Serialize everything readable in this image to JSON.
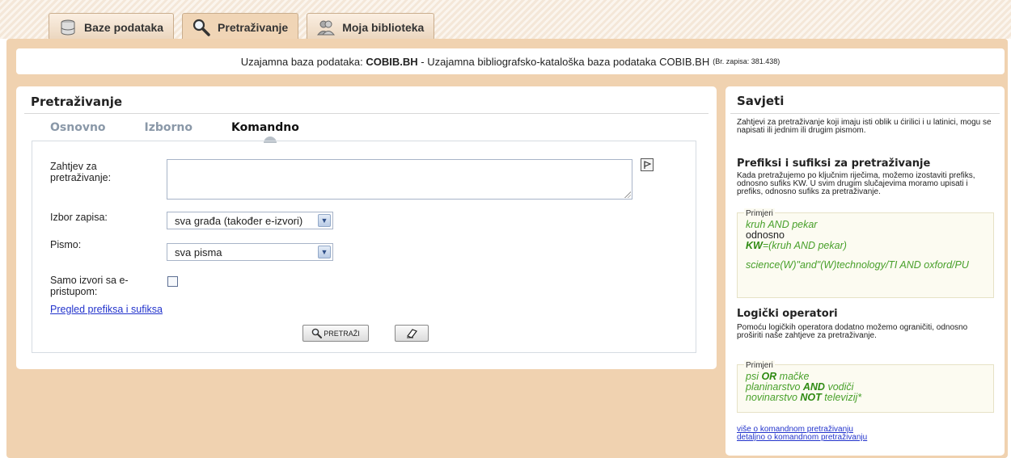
{
  "tabs": [
    {
      "label": "Baze podataka",
      "icon": "database-icon",
      "active": false
    },
    {
      "label": "Pretraživanje",
      "icon": "search-icon",
      "active": true
    },
    {
      "label": "Moja biblioteka",
      "icon": "users-icon",
      "active": false
    }
  ],
  "info_bar": {
    "prefix": "Uzajamna baza podataka:",
    "db_code": "COBIB.BH",
    "desc": "- Uzajamna bibliografsko-kataloška baza podataka COBIB.BH",
    "count": "(Br. zapisa: 381.438)"
  },
  "search_panel": {
    "title": "Pretraživanje",
    "subtabs": [
      "Osnovno",
      "Izborno",
      "Komandno"
    ],
    "active_subtab": "Komandno",
    "query_label": "Zahtjev za pretraživanje:",
    "query_value": "",
    "record_label": "Izbor zapisa:",
    "record_value": "sva građa (također e-izvori)",
    "script_label": "Pismo:",
    "script_value": "sva pisma",
    "eaccess_label": "Samo izvori sa e-pristupom:",
    "eaccess_checked": false,
    "prefix_link": "Pregled prefiksa i sufiksa",
    "search_button": "PRETRAŽI"
  },
  "tips": {
    "title": "Savjeti",
    "intro": "Zahtjevi za pretraživanje koji imaju isti oblik u ćirilici i u latinici, mogu se napisati ili jednim ili drugim pismom.",
    "prefix_title": "Prefiksi i sufiksi za pretraživanje",
    "prefix_text": "Kada pretražujemo po ključnim riječima, možemo izostaviti prefiks, odnosno sufiks KW. U svim drugim slučajevima moramo upisati i prefiks, odnosno sufiks za pretraživanje.",
    "examples_label": "Primjeri",
    "ex1_line1": "kruh AND pekar",
    "ex1_line2": "odnosno",
    "ex1_line3_bold": "KW",
    "ex1_line3_rest": "=(kruh AND pekar)",
    "ex1_line4": "science(W)\"and\"(W)technology/TI AND oxford/PU",
    "logic_title": "Logički operatori",
    "logic_text": "Pomoću logičkih operatora dodatno možemo ograničiti, odnosno proširiti naše zahtjeve za pretraživanje.",
    "ex2_1a": "psi ",
    "ex2_1b": "OR",
    "ex2_1c": " mačke",
    "ex2_2a": "planinarstvo ",
    "ex2_2b": "AND",
    "ex2_2c": " vodiči",
    "ex2_3a": "novinarstvo ",
    "ex2_3b": "NOT",
    "ex2_3c": " televizij*",
    "link1": "više o komandnom pretraživanju",
    "link2": "detaljno o komandnom pretraživanju"
  },
  "colors": {
    "page_accent": "#f0d2b0",
    "link": "#2233cc",
    "example_green": "#48a02a"
  }
}
